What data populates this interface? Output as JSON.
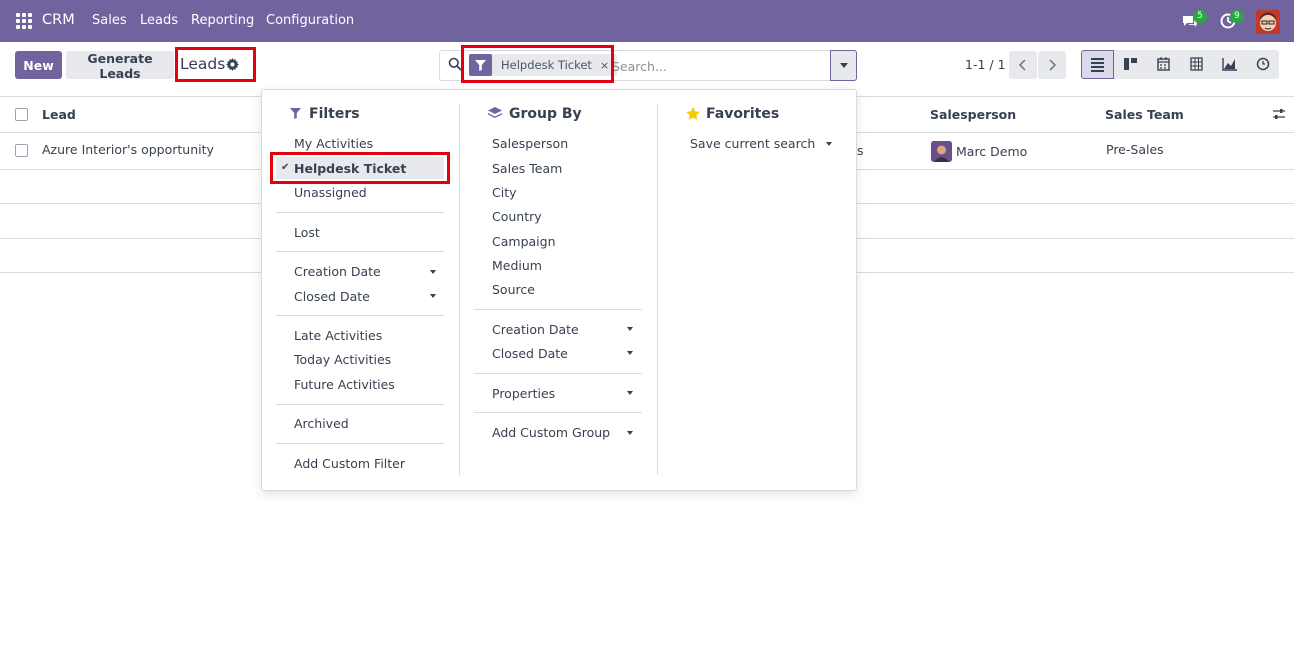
{
  "navbar": {
    "brand": "CRM",
    "menus": [
      "Sales",
      "Leads",
      "Reporting",
      "Configuration"
    ],
    "messages_badge": "5",
    "activities_badge": "9",
    "bg_color": "#71639e"
  },
  "control_panel": {
    "new_label": "New",
    "generate_label": "Generate Leads",
    "breadcrumb": "Leads",
    "facet_label": "Helpdesk Ticket",
    "facet_close": "×",
    "search_placeholder": "Search...",
    "pager": "1-1 / 1",
    "views": [
      "list-icon",
      "kanban-icon",
      "calendar-icon",
      "pivot-icon",
      "graph-icon",
      "activity-icon"
    ]
  },
  "list": {
    "columns": [
      "Lead",
      "Salesperson",
      "Sales Team"
    ],
    "rows": [
      {
        "lead": "Azure Interior's opportunity",
        "partial": "s",
        "salesperson": "Marc Demo",
        "team": "Pre-Sales"
      }
    ]
  },
  "filters": {
    "title": "Filters",
    "items": [
      "My Activities",
      "Helpdesk Ticket",
      "Unassigned",
      "Lost",
      "Creation Date",
      "Closed Date",
      "Late Activities",
      "Today Activities",
      "Future Activities",
      "Archived",
      "Add Custom Filter"
    ],
    "selected": "Helpdesk Ticket"
  },
  "group_by": {
    "title": "Group By",
    "items": [
      "Salesperson",
      "Sales Team",
      "City",
      "Country",
      "Campaign",
      "Medium",
      "Source",
      "Creation Date",
      "Closed Date",
      "Properties",
      "Add Custom Group"
    ]
  },
  "favorites": {
    "title": "Favorites",
    "items": [
      "Save current search"
    ]
  },
  "accent_color": "#71639e",
  "highlight_color": "#e3000f"
}
